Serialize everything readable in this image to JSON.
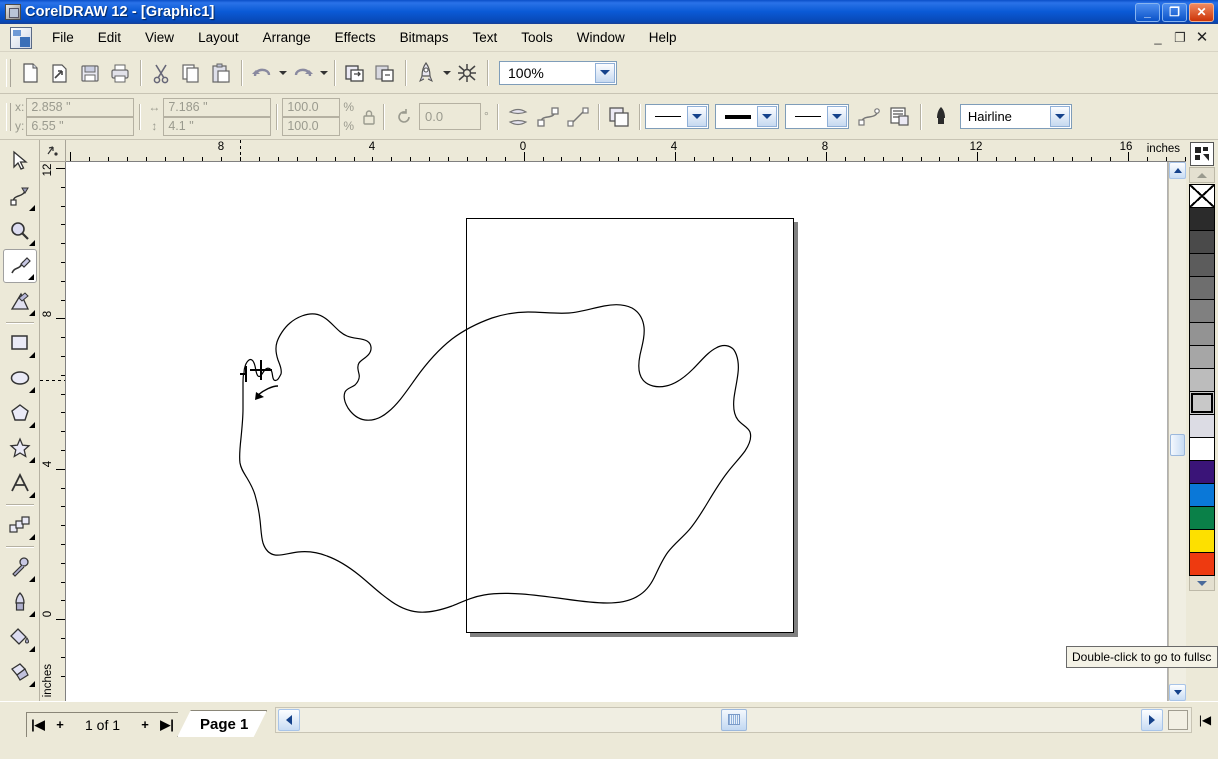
{
  "window": {
    "title": "CorelDRAW 12 - [Graphic1]",
    "app_icon": "coreldraw-icon",
    "buttons": {
      "minimize": "_",
      "maximize": "❐",
      "close": "✕"
    },
    "doc_buttons": {
      "minimize": "_",
      "restore": "❐",
      "close": "✕"
    }
  },
  "menu": {
    "items": [
      {
        "label": "File",
        "accel": "F"
      },
      {
        "label": "Edit",
        "accel": "E"
      },
      {
        "label": "View",
        "accel": "V"
      },
      {
        "label": "Layout",
        "accel": "L"
      },
      {
        "label": "Arrange",
        "accel": "A"
      },
      {
        "label": "Effects",
        "accel": "c"
      },
      {
        "label": "Bitmaps",
        "accel": "B"
      },
      {
        "label": "Text",
        "accel": "T"
      },
      {
        "label": "Tools",
        "accel": "o"
      },
      {
        "label": "Window",
        "accel": "W"
      },
      {
        "label": "Help",
        "accel": "H"
      }
    ]
  },
  "toolbar": {
    "buttons": [
      {
        "name": "new-document-button",
        "tooltip": "New"
      },
      {
        "name": "open-document-button",
        "tooltip": "Open"
      },
      {
        "name": "save-document-button",
        "tooltip": "Save"
      },
      {
        "name": "print-button",
        "tooltip": "Print"
      },
      {
        "name": "cut-button",
        "tooltip": "Cut"
      },
      {
        "name": "copy-button",
        "tooltip": "Copy"
      },
      {
        "name": "paste-button",
        "tooltip": "Paste"
      },
      {
        "name": "undo-button",
        "tooltip": "Undo"
      },
      {
        "name": "redo-button",
        "tooltip": "Redo"
      },
      {
        "name": "import-button",
        "tooltip": "Import"
      },
      {
        "name": "export-button",
        "tooltip": "Export"
      },
      {
        "name": "app-launcher-button",
        "tooltip": "Application Launcher"
      },
      {
        "name": "corel-online-button",
        "tooltip": "Corel Online"
      }
    ],
    "zoom_level": "100%"
  },
  "property_bar": {
    "x_label": "x:",
    "x_value": "2.858 \"",
    "y_label": "y:",
    "y_value": "6.55 \"",
    "width_value": "7.186 \"",
    "height_value": "4.1 \"",
    "scale_h": "100.0",
    "scale_v": "100.0",
    "percent_symbol": "%",
    "rotation_value": "0.0",
    "degree_symbol": "°",
    "outline_width": "Hairline"
  },
  "toolbox": {
    "tools": [
      {
        "name": "pick-tool",
        "label": "Pick",
        "active": false,
        "flyout": false
      },
      {
        "name": "shape-tool",
        "label": "Shape",
        "active": false,
        "flyout": true
      },
      {
        "name": "zoom-tool",
        "label": "Zoom",
        "active": false,
        "flyout": true
      },
      {
        "name": "freehand-tool",
        "label": "Freehand",
        "active": true,
        "flyout": true
      },
      {
        "name": "smart-drawing-tool",
        "label": "Smart Drawing",
        "active": false,
        "flyout": true
      },
      {
        "name": "rectangle-tool",
        "label": "Rectangle",
        "active": false,
        "flyout": true
      },
      {
        "name": "ellipse-tool",
        "label": "Ellipse",
        "active": false,
        "flyout": true
      },
      {
        "name": "polygon-tool",
        "label": "Polygon",
        "active": false,
        "flyout": true
      },
      {
        "name": "star-shapes-tool",
        "label": "Basic Shapes",
        "active": false,
        "flyout": true
      },
      {
        "name": "text-tool",
        "label": "Text",
        "active": false,
        "flyout": true
      },
      {
        "name": "interactive-blend-tool",
        "label": "Interactive Blend",
        "active": false,
        "flyout": true
      },
      {
        "name": "eyedropper-tool",
        "label": "Eyedropper",
        "active": false,
        "flyout": true
      },
      {
        "name": "outline-pen-tool",
        "label": "Outline",
        "active": false,
        "flyout": true
      },
      {
        "name": "fill-tool",
        "label": "Fill",
        "active": false,
        "flyout": true
      },
      {
        "name": "interactive-fill-tool",
        "label": "Interactive Fill",
        "active": false,
        "flyout": true
      }
    ]
  },
  "rulers": {
    "unit": "inches",
    "horizontal_labels": [
      "8",
      "4",
      "0",
      "4",
      "8",
      "12",
      "16"
    ],
    "vertical_labels": [
      "12",
      "8",
      "4",
      "0"
    ]
  },
  "palette": {
    "no_color_label": "X",
    "swatches": [
      {
        "name": "no-color",
        "hex": "none"
      },
      {
        "name": "black",
        "hex": "#2b2b2b"
      },
      {
        "name": "gray-90",
        "hex": "#4a4a4a"
      },
      {
        "name": "gray-80",
        "hex": "#5c5c5c"
      },
      {
        "name": "gray-70",
        "hex": "#6e6e6e"
      },
      {
        "name": "gray-60",
        "hex": "#808080"
      },
      {
        "name": "gray-50",
        "hex": "#939393"
      },
      {
        "name": "gray-40",
        "hex": "#a6a6a6"
      },
      {
        "name": "gray-30",
        "hex": "#bcbcbc"
      },
      {
        "name": "gray-20",
        "hex": "#c8c8c8",
        "selected": true
      },
      {
        "name": "gray-10",
        "hex": "#dcdce4"
      },
      {
        "name": "white",
        "hex": "#ffffff"
      },
      {
        "name": "dark-purple",
        "hex": "#3a1478"
      },
      {
        "name": "blue",
        "hex": "#0a78d8"
      },
      {
        "name": "green",
        "hex": "#0a8048"
      },
      {
        "name": "yellow",
        "hex": "#fde000"
      },
      {
        "name": "red",
        "hex": "#ee3a10"
      }
    ]
  },
  "page_navigator": {
    "first_page_icon": "|◀",
    "add_page_left": "+",
    "page_count_text": "1 of 1",
    "add_page_right": "+",
    "last_page_icon": "▶|",
    "tab_label": "Page 1"
  },
  "tooltip": {
    "text": "Double-click to go to fullsc"
  },
  "document": {
    "page_shape": "rectangle-with-shadow",
    "drawn_object": "freehand-blob-outline",
    "outline_color": "#000000"
  }
}
